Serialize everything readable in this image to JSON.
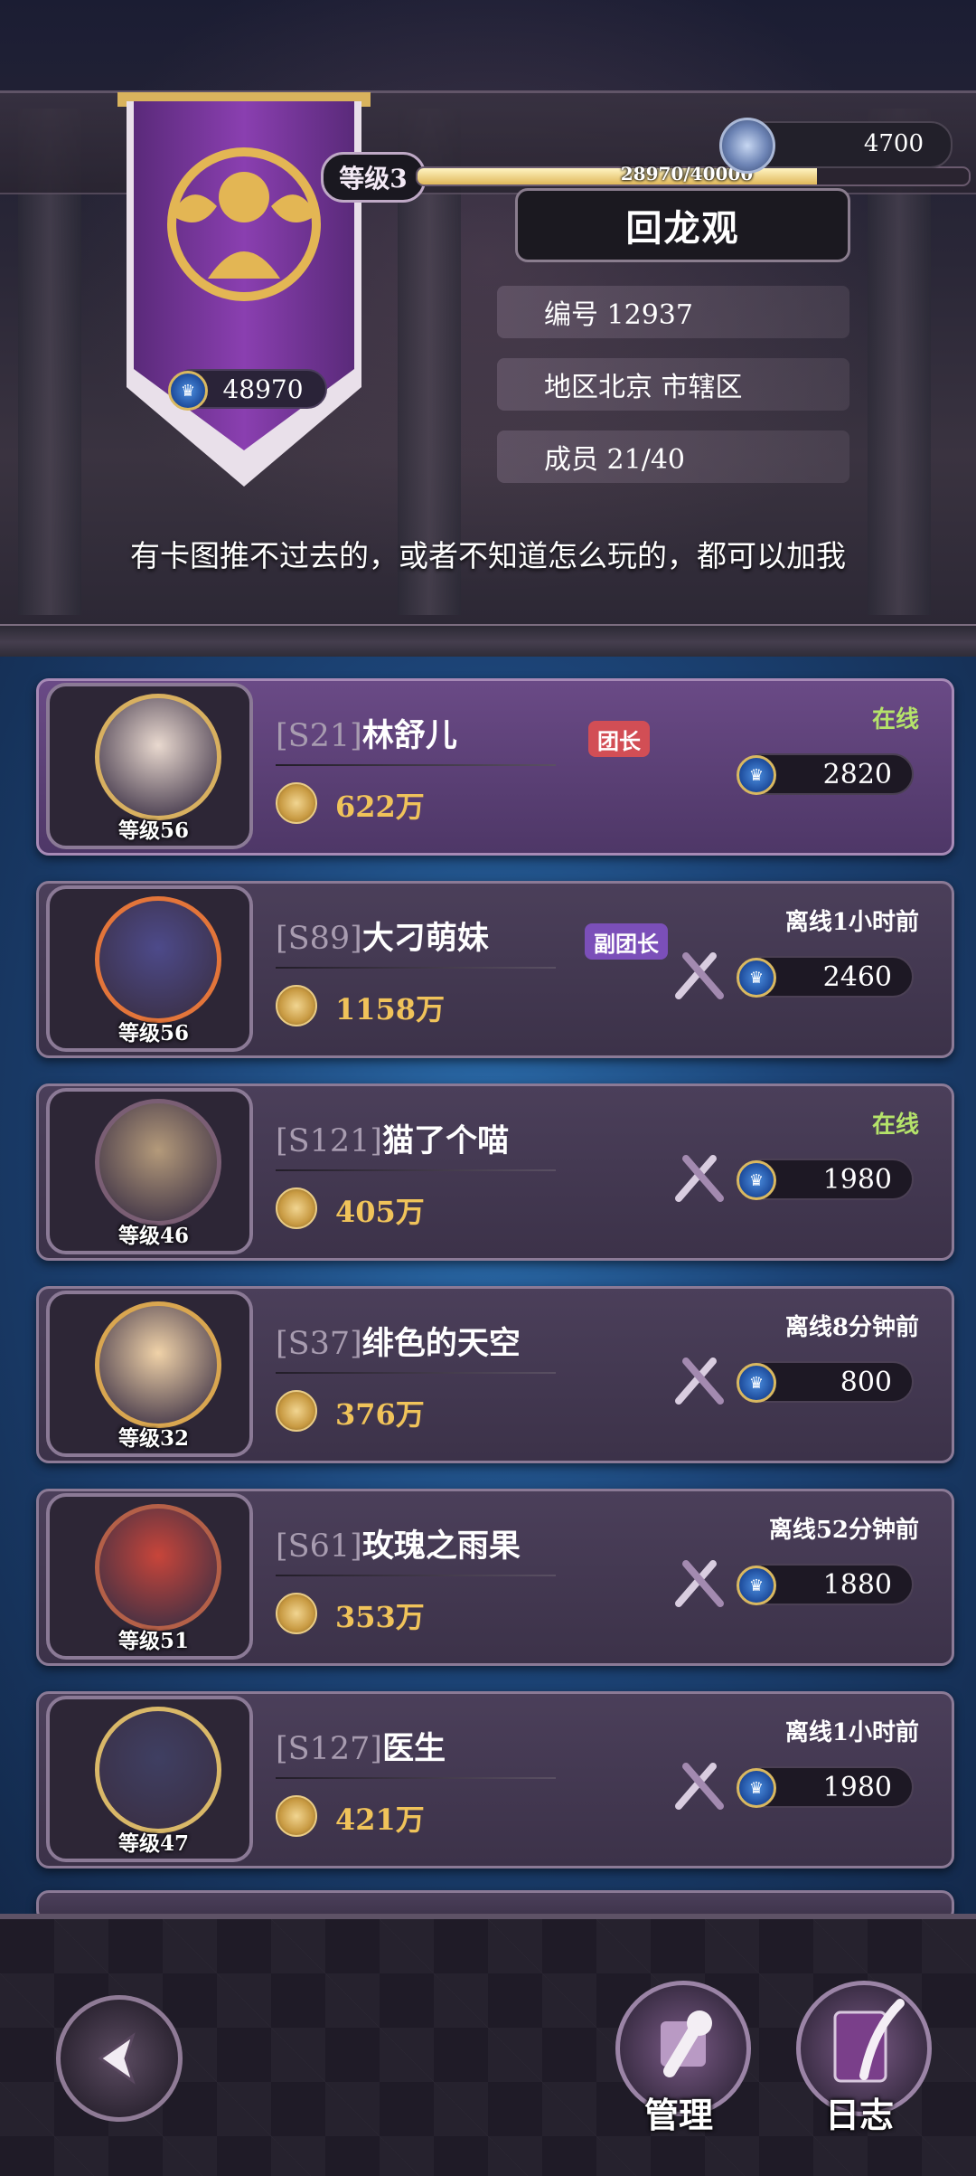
{
  "header": {
    "level_label": "等级3",
    "xp_text": "28970/40000",
    "xp_fraction": 0.724,
    "currency_value": "4700",
    "guild_name": "回龙观",
    "banner_score": "48970",
    "info": {
      "id": "编号 12937",
      "region": "地区北京 市辖区",
      "members": "成员 21/40"
    },
    "motto": "有卡图推不过去的，或者不知道怎么玩的，都可以加我"
  },
  "members": [
    {
      "server": "[S21]",
      "name": "林舒儿",
      "role": "团长",
      "level": "等级56",
      "power": "622万",
      "status": "在线",
      "score": "2820",
      "avatar_color": "#e9d9cf",
      "frame_color": "#d8b060"
    },
    {
      "server": "[S89]",
      "name": "大刁萌妹",
      "role": "副团长",
      "level": "等级56",
      "power": "1158万",
      "status": "离线1小时前",
      "score": "2460",
      "avatar_color": "#4d4a8a",
      "frame_color": "#e3753a"
    },
    {
      "server": "[S121]",
      "name": "猫了个喵",
      "role": "",
      "level": "等级46",
      "power": "405万",
      "status": "在线",
      "score": "1980",
      "avatar_color": "#b49a7a",
      "frame_color": "#7a5e74"
    },
    {
      "server": "[S37]",
      "name": "绯色的天空",
      "role": "",
      "level": "等级32",
      "power": "376万",
      "status": "离线8分钟前",
      "score": "800",
      "avatar_color": "#f0d2a8",
      "frame_color": "#d9a650"
    },
    {
      "server": "[S61]",
      "name": "玫瑰之雨果",
      "role": "",
      "level": "等级51",
      "power": "353万",
      "status": "离线52分钟前",
      "score": "1880",
      "avatar_color": "#c8453a",
      "frame_color": "#b46048"
    },
    {
      "server": "[S127]",
      "name": "医生",
      "role": "",
      "level": "等级47",
      "power": "421万",
      "status": "离线1小时前",
      "score": "1980",
      "avatar_color": "#3f3f62",
      "frame_color": "#d9b868"
    }
  ],
  "footer": {
    "manage_label": "管理",
    "log_label": "日志"
  }
}
